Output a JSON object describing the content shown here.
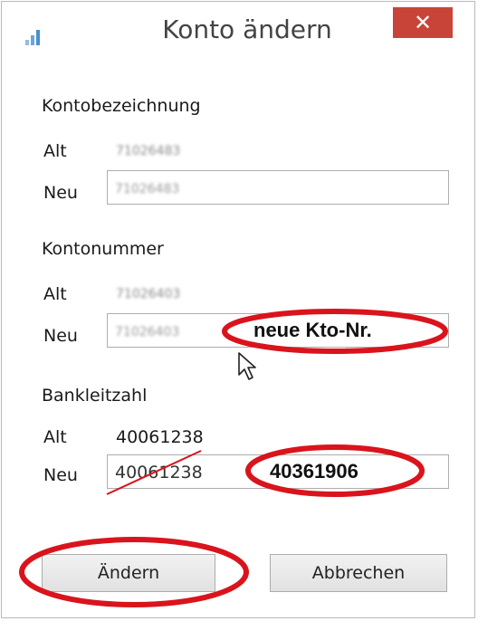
{
  "window": {
    "title": "Konto ändern",
    "close_label": "✕"
  },
  "sections": {
    "konto_bezeichnung": {
      "heading": "Kontobezeichnung",
      "alt_label": "Alt",
      "alt_value": "71026483",
      "neu_label": "Neu",
      "neu_value": "71026483"
    },
    "kontonummer": {
      "heading": "Kontonummer",
      "alt_label": "Alt",
      "alt_value": "71026403",
      "neu_label": "Neu",
      "neu_value": "71026403"
    },
    "bankleitzahl": {
      "heading": "Bankleitzahl",
      "alt_label": "Alt",
      "alt_value": "40061238",
      "neu_label": "Neu",
      "neu_value": "40061238"
    }
  },
  "annotations": {
    "kontonummer_note": "neue Kto-Nr.",
    "blz_note": "40361906",
    "highlight_color": "#d9141c"
  },
  "buttons": {
    "aendern_label": "Ändern",
    "abbrechen_label": "Abbrechen"
  }
}
